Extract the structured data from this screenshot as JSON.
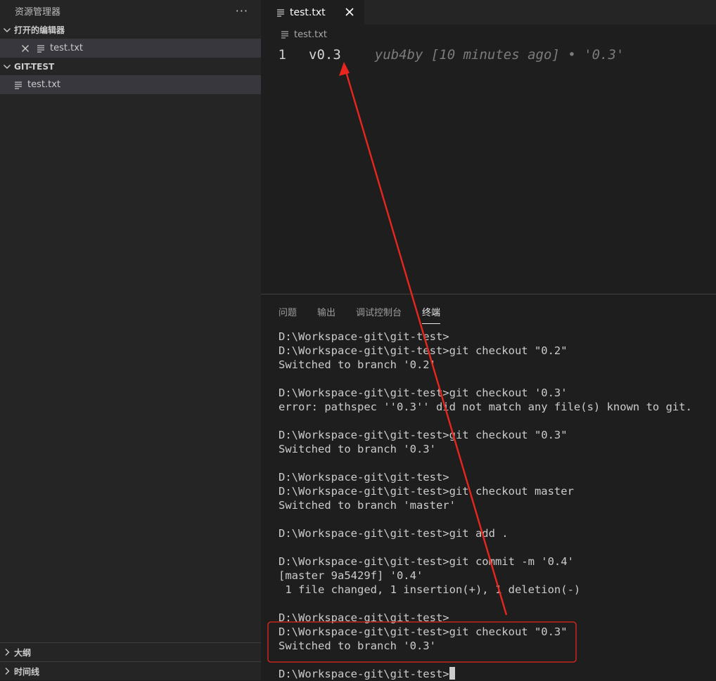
{
  "sidebar": {
    "title": "资源管理器",
    "more_label": "···",
    "open_editors": {
      "header": "打开的编辑器",
      "items": [
        {
          "label": "test.txt"
        }
      ]
    },
    "folder": {
      "header": "GIT-TEST",
      "items": [
        {
          "label": "test.txt"
        }
      ]
    },
    "outline_header": "大纲",
    "timeline_header": "时间线"
  },
  "editor": {
    "tabs": [
      {
        "label": "test.txt"
      }
    ],
    "breadcrumb": "test.txt",
    "lines": [
      {
        "number": "1",
        "text": "v0.3",
        "blame": "yub4by [10 minutes ago] • '0.3'"
      }
    ]
  },
  "panel": {
    "tabs": [
      "问题",
      "输出",
      "调试控制台",
      "终端"
    ],
    "active_tab": "终端",
    "terminal_lines": [
      "D:\\Workspace-git\\git-test>",
      "D:\\Workspace-git\\git-test>git checkout \"0.2\"",
      "Switched to branch '0.2'",
      "",
      "D:\\Workspace-git\\git-test>git checkout '0.3'",
      "error: pathspec ''0.3'' did not match any file(s) known to git.",
      "",
      "D:\\Workspace-git\\git-test>git checkout \"0.3\"",
      "Switched to branch '0.3'",
      "",
      "D:\\Workspace-git\\git-test>",
      "D:\\Workspace-git\\git-test>git checkout master",
      "Switched to branch 'master'",
      "",
      "D:\\Workspace-git\\git-test>git add .",
      "",
      "D:\\Workspace-git\\git-test>git commit -m '0.4'",
      "[master 9a5429f] '0.4'",
      " 1 file changed, 1 insertion(+), 1 deletion(-)",
      "",
      "D:\\Workspace-git\\git-test>",
      "D:\\Workspace-git\\git-test>git checkout \"0.3\"",
      "Switched to branch '0.3'",
      "",
      "D:\\Workspace-git\\git-test>"
    ]
  },
  "colors": {
    "annotation": "#e8261f"
  }
}
